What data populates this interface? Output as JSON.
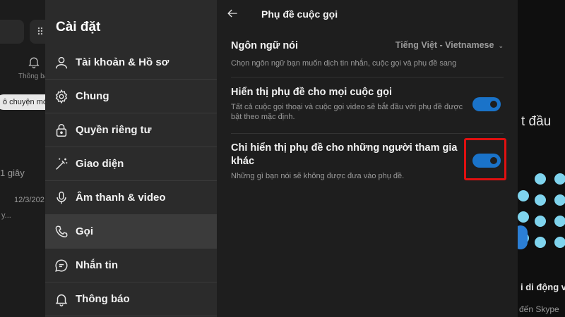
{
  "background_app": {
    "notifications_label": "Thông bá",
    "chip_text": "ô chuyện mớ",
    "time_1": "1 giây",
    "time_2": "12/3/202",
    "preview": "y...",
    "right_start_text": "t đầu",
    "right_mobile_text": "i di động v",
    "right_skype_text": "đến Skype"
  },
  "nav": {
    "title": "Cài đặt",
    "items": [
      {
        "label": "Tài khoản & Hồ sơ",
        "icon": "person-icon"
      },
      {
        "label": "Chung",
        "icon": "gear-icon"
      },
      {
        "label": "Quyền riêng tư",
        "icon": "lock-icon"
      },
      {
        "label": "Giao diện",
        "icon": "magic-wand-icon"
      },
      {
        "label": "Âm thanh & video",
        "icon": "microphone-icon"
      },
      {
        "label": "Gọi",
        "icon": "phone-icon",
        "active": true
      },
      {
        "label": "Nhắn tin",
        "icon": "chat-bubble-icon"
      },
      {
        "label": "Thông báo",
        "icon": "bell-icon"
      }
    ]
  },
  "content": {
    "title": "Phụ đề cuộc gọi",
    "language": {
      "title": "Ngôn ngữ nói",
      "value": "Tiếng Việt - Vietnamese",
      "description": "Chọn ngôn ngữ bạn muốn dịch tin nhắn, cuộc gọi và phụ đề sang"
    },
    "show_all": {
      "title": "Hiển thị phụ đề cho mọi cuộc gọi",
      "description": "Tất cả cuộc gọi thoại và cuộc gọi video sẽ bắt đầu với phụ đề được bật theo mặc định.",
      "enabled": true
    },
    "show_others": {
      "title": "Chỉ hiển thị phụ đề cho những người tham gia khác",
      "description": "Những gì bạn nói sẽ không được đưa vào phụ đề.",
      "enabled": true
    }
  },
  "colors": {
    "toggle_on": "#1a73c9",
    "highlight": "#e01010",
    "accent_dots": "#7fd4ee"
  }
}
